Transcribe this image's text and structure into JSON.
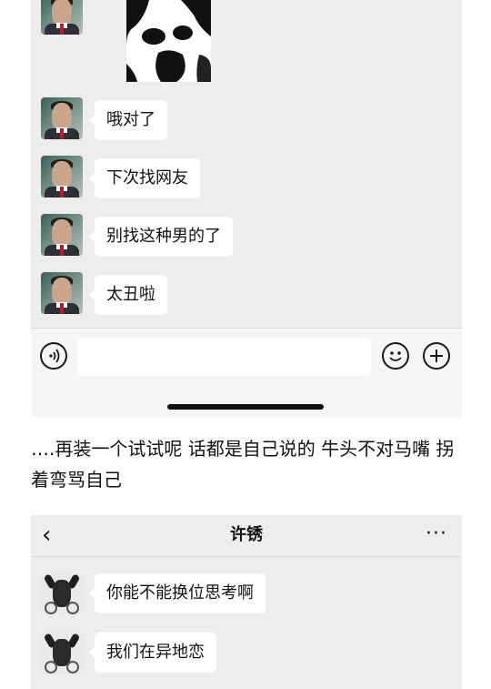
{
  "top_chat": {
    "messages": [
      {
        "type": "sticker",
        "icon": "sticker-image"
      },
      {
        "type": "text",
        "text": "哦对了"
      },
      {
        "type": "text",
        "text": "下次找网友"
      },
      {
        "type": "text",
        "text": "别找这种男的了"
      },
      {
        "type": "text",
        "text": "太丑啦"
      }
    ],
    "input_bar": {
      "voice_icon": "voice-icon",
      "emoji_icon": "emoji-icon",
      "plus_icon": "plus-icon",
      "input_value": ""
    }
  },
  "caption": "….再装一个试试呢 话都是自己说的 牛头不对马嘴 拐着弯骂自己",
  "bottom_chat": {
    "header": {
      "back": "‹",
      "title": "许锈",
      "more": "···"
    },
    "messages": [
      {
        "type": "text",
        "text": "你能不能换位思考啊"
      },
      {
        "type": "text",
        "text": "我们在异地恋"
      }
    ]
  },
  "colors": {
    "chat_bg": "#ededed",
    "bubble_bg": "#ffffff",
    "input_bar_bg": "#f6f6f6"
  }
}
